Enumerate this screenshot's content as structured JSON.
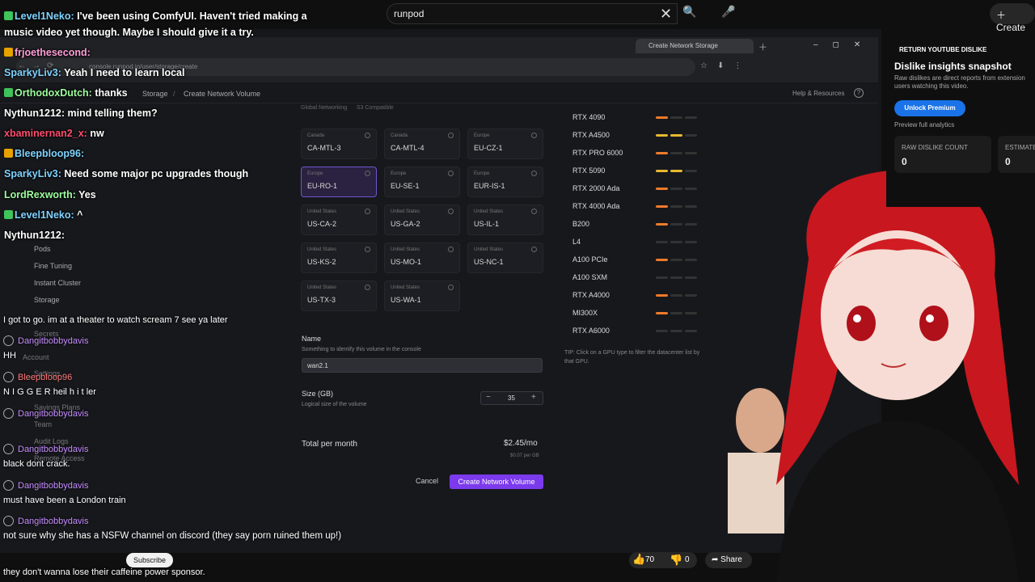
{
  "top": {
    "search_value": "runpod",
    "create_label": "Create"
  },
  "browser": {
    "tab_title": "Create Network Storage",
    "url": "console.runpod.io/user/storage/create"
  },
  "app": {
    "breadcrumb": {
      "root": "Storage",
      "current": "Create Network Volume"
    },
    "help": "Help & Resources",
    "sidebar": [
      "Pods",
      "Fine Tuning",
      "Instant Cluster",
      "Storage",
      "Secrets",
      "Settings",
      "Savings Plans",
      "Team",
      "Audit Logs",
      "Remote Access"
    ],
    "sidebar_headers": {
      "account": "Account"
    },
    "filters": [
      "Global Networking",
      "S3 Compatible"
    ],
    "datacenters": [
      {
        "region": "Canada",
        "code": "CA-MTL-3"
      },
      {
        "region": "Canada",
        "code": "CA-MTL-4"
      },
      {
        "region": "Europe",
        "code": "EU-CZ-1"
      },
      {
        "region": "Europe",
        "code": "EU-RO-1"
      },
      {
        "region": "Europe",
        "code": "EU-SE-1"
      },
      {
        "region": "Europe",
        "code": "EUR-IS-1"
      },
      {
        "region": "United States",
        "code": "US-CA-2"
      },
      {
        "region": "United States",
        "code": "US-GA-2"
      },
      {
        "region": "United States",
        "code": "US-IL-1"
      },
      {
        "region": "United States",
        "code": "US-KS-2"
      },
      {
        "region": "United States",
        "code": "US-MO-1"
      },
      {
        "region": "United States",
        "code": "US-NC-1"
      },
      {
        "region": "United States",
        "code": "US-TX-3"
      },
      {
        "region": "United States",
        "code": "US-WA-1"
      }
    ],
    "selected_datacenter": "EU-RO-1",
    "gpus": [
      {
        "name": "RTX 4090",
        "availability": "low"
      },
      {
        "name": "RTX A4500",
        "availability": "medium"
      },
      {
        "name": "RTX PRO 6000",
        "availability": "low"
      },
      {
        "name": "RTX 5090",
        "availability": "medium"
      },
      {
        "name": "RTX 2000 Ada",
        "availability": "low"
      },
      {
        "name": "RTX 4000 Ada",
        "availability": "low"
      },
      {
        "name": "B200",
        "availability": "low"
      },
      {
        "name": "L4",
        "availability": "none"
      },
      {
        "name": "A100 PCIe",
        "availability": "low"
      },
      {
        "name": "A100 SXM",
        "availability": "none"
      },
      {
        "name": "RTX A4000",
        "availability": "low"
      },
      {
        "name": "MI300X",
        "availability": "low"
      },
      {
        "name": "RTX A6000",
        "availability": "none"
      }
    ],
    "tip": "TIP: Click on a GPU type to filter the datacenter list by that GPU.",
    "name_label": "Name",
    "name_sub": "Something to identify this volume in the console",
    "name_value": "wan2.1",
    "size_label": "Size (GB)",
    "size_sub": "Logical size of the volume",
    "size_value": "35",
    "total_label": "Total per month",
    "total_value": "$2.45/mo",
    "per_gb": "$0.07 per GB",
    "cancel": "Cancel",
    "create": "Create Network Volume"
  },
  "chat_top": [
    {
      "user": "Level1Neko:",
      "text": "I've been using ComfyUI. Haven't tried making a",
      "color": "#7fd3ff",
      "badge": "#3ec45a"
    },
    {
      "user": "",
      "text": "music video yet though. Maybe I should give it a try.",
      "color": "#fff",
      "badge": ""
    },
    {
      "user": "frjoethesecond:",
      "text": "",
      "color": "#ff9eda",
      "badge": "#e8a200"
    },
    {
      "user": "SparkyLiv3:",
      "text": "Yeah I need to learn local",
      "color": "#7fd3ff",
      "badge": ""
    },
    {
      "user": "OrthodoxDutch:",
      "text": "thanks",
      "color": "#9dff9d",
      "badge": "#3ec45a"
    },
    {
      "user": "Nythun1212:",
      "text": "mind telling them?",
      "color": "#fff",
      "badge": ""
    },
    {
      "user": "xbaminernan2_x:",
      "text": "nw",
      "color": "#ff4d6d",
      "badge": ""
    },
    {
      "user": "Bleepbloop96:",
      "text": "",
      "color": "#7fd3ff",
      "badge": "#e8a200"
    },
    {
      "user": "SparkyLiv3:",
      "text": "Need some major pc upgrades though",
      "color": "#7fd3ff",
      "badge": ""
    },
    {
      "user": "LordRexworth:",
      "text": "Yes",
      "color": "#9dff9d",
      "badge": ""
    },
    {
      "user": "Level1Neko:",
      "text": "^",
      "color": "#7fd3ff",
      "badge": "#3ec45a"
    },
    {
      "user": "Nythun1212:",
      "text": "",
      "color": "#fff",
      "badge": ""
    }
  ],
  "chat_bottom": [
    {
      "user": "",
      "text": "I got to go. im at a theater to watch scream 7 see ya later"
    },
    {
      "user": "Dangitbobbydavis",
      "text": "HH",
      "color": "#c58cff"
    },
    {
      "user": "Bleepbloop96",
      "text": "N I G G E R heil h i t ler",
      "color": "#ff7a7a"
    },
    {
      "user": "Dangitbobbydavis",
      "text": "",
      "color": "#c58cff"
    },
    {
      "user": "Dangitbobbydavis",
      "text": "black dont crack.",
      "color": "#c58cff"
    },
    {
      "user": "Dangitbobbydavis",
      "text": "must have been a London train",
      "color": "#c58cff"
    },
    {
      "user": "Dangitbobbydavis",
      "text": "they don't wanna lose their caffeine power sponsor.",
      "color": "#c58cff"
    }
  ],
  "overlay_text": "not sure why she has a NSFW channel on discord (they say porn ruined them up!)",
  "extension": {
    "title": "RETURN YOUTUBE DISLIKE",
    "heading": "Dislike insights snapshot",
    "desc": "Raw dislikes are direct reports from extension users watching this video.",
    "unlock": "Unlock Premium",
    "preview": "Preview full analytics",
    "raw_label": "RAW DISLIKE COUNT",
    "raw_value": "0",
    "est_label": "ESTIMATE",
    "est_value": "0"
  },
  "bottom": {
    "subscribe": "Subscribe",
    "likes": "70",
    "dislikes": "0",
    "share": "Share"
  },
  "colors": {
    "accent": "#7c3aed",
    "yt_blue": "#1a73e8"
  }
}
